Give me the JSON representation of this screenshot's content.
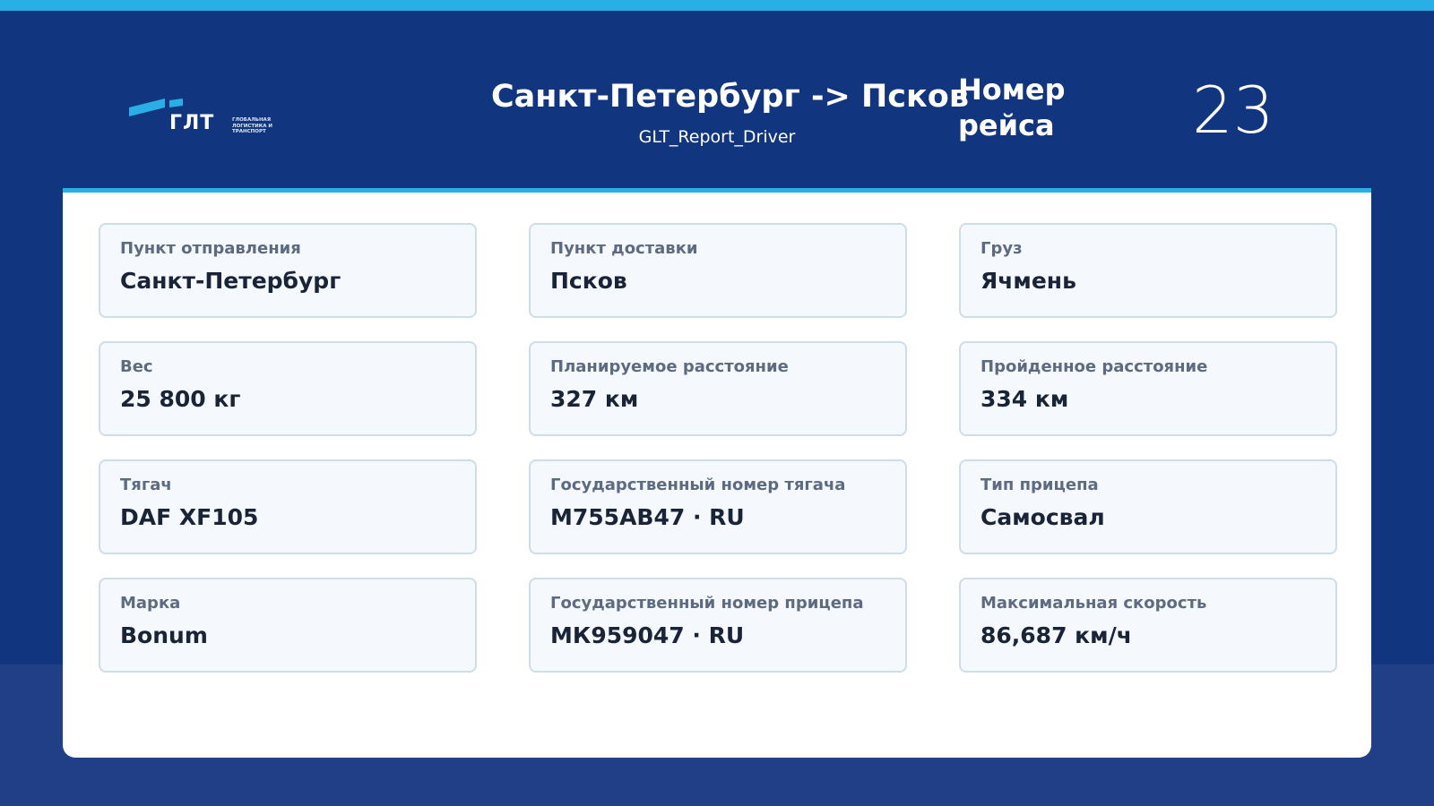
{
  "header": {
    "logo": {
      "text": "ГЛТ",
      "subtitle": "ГЛОБАЛЬНАЯ ЛОГИСТИКА И ТРАНСПОРТ",
      "accent_color": "#29aee6"
    },
    "route_title": "Санкт-Петербург -> Псков",
    "report_name": "GLT_Report_Driver",
    "trip_label": "Номер рейса",
    "trip_number": "23"
  },
  "cards": [
    {
      "label": "Пункт отправления",
      "value": "Санкт-Петербург"
    },
    {
      "label": "Пункт доставки",
      "value": "Псков"
    },
    {
      "label": "Груз",
      "value": "Ячмень"
    },
    {
      "label": "Вес",
      "value": "25 800 кг"
    },
    {
      "label": "Планируемое расстояние",
      "value": "327 км"
    },
    {
      "label": "Пройденное расстояние",
      "value": "334 км"
    },
    {
      "label": "Тягач",
      "value": "DAF XF105"
    },
    {
      "label": "Государственный номер тягача",
      "value": "М755АВ47 · RU"
    },
    {
      "label": "Тип прицепа",
      "value": "Самосвал"
    },
    {
      "label": "Марка",
      "value": "Bonum"
    },
    {
      "label": "Государственный номер прицепа",
      "value": "МК959047 · RU"
    },
    {
      "label": "Максимальная скорость",
      "value": "86,687 км/ч"
    }
  ],
  "colors": {
    "background": "#12357f",
    "accent": "#29aee6",
    "card_background": "#f5f9fe",
    "card_border": "#cdddec"
  }
}
